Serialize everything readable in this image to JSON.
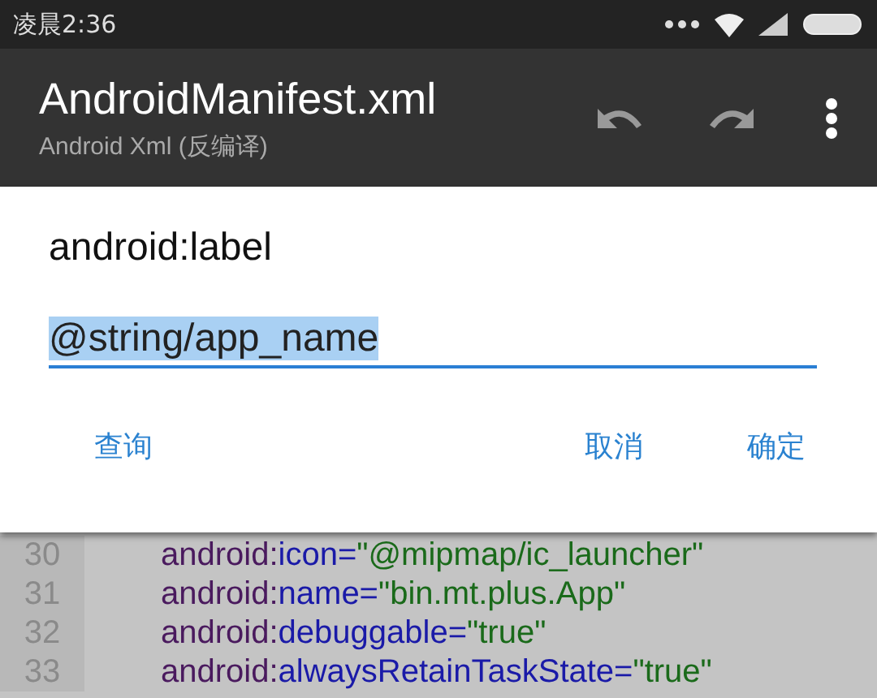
{
  "status_bar": {
    "time": "凌晨2:36"
  },
  "toolbar": {
    "title": "AndroidManifest.xml",
    "subtitle": "Android Xml (反编译)"
  },
  "dialog": {
    "title": "android:label",
    "field": {
      "value": "@string/app_name",
      "selected": true
    },
    "buttons": [
      {
        "label": "查询",
        "kind": "left"
      },
      {
        "label": "取消",
        "kind": "right"
      },
      {
        "label": "确定",
        "kind": "right"
      }
    ]
  },
  "code_lines": [
    {
      "number": "30",
      "namespace": "android:",
      "attribute": "icon=",
      "value": "\"@mipmap/ic_launcher\""
    },
    {
      "number": "31",
      "namespace": "android:",
      "attribute": "name=",
      "value": "\"bin.mt.plus.App\""
    },
    {
      "number": "32",
      "namespace": "android:",
      "attribute": "debuggable=",
      "value": "\"true\""
    },
    {
      "number": "33",
      "namespace": "android:",
      "attribute": "alwaysRetainTaskState=",
      "value": "\"true\""
    }
  ]
}
